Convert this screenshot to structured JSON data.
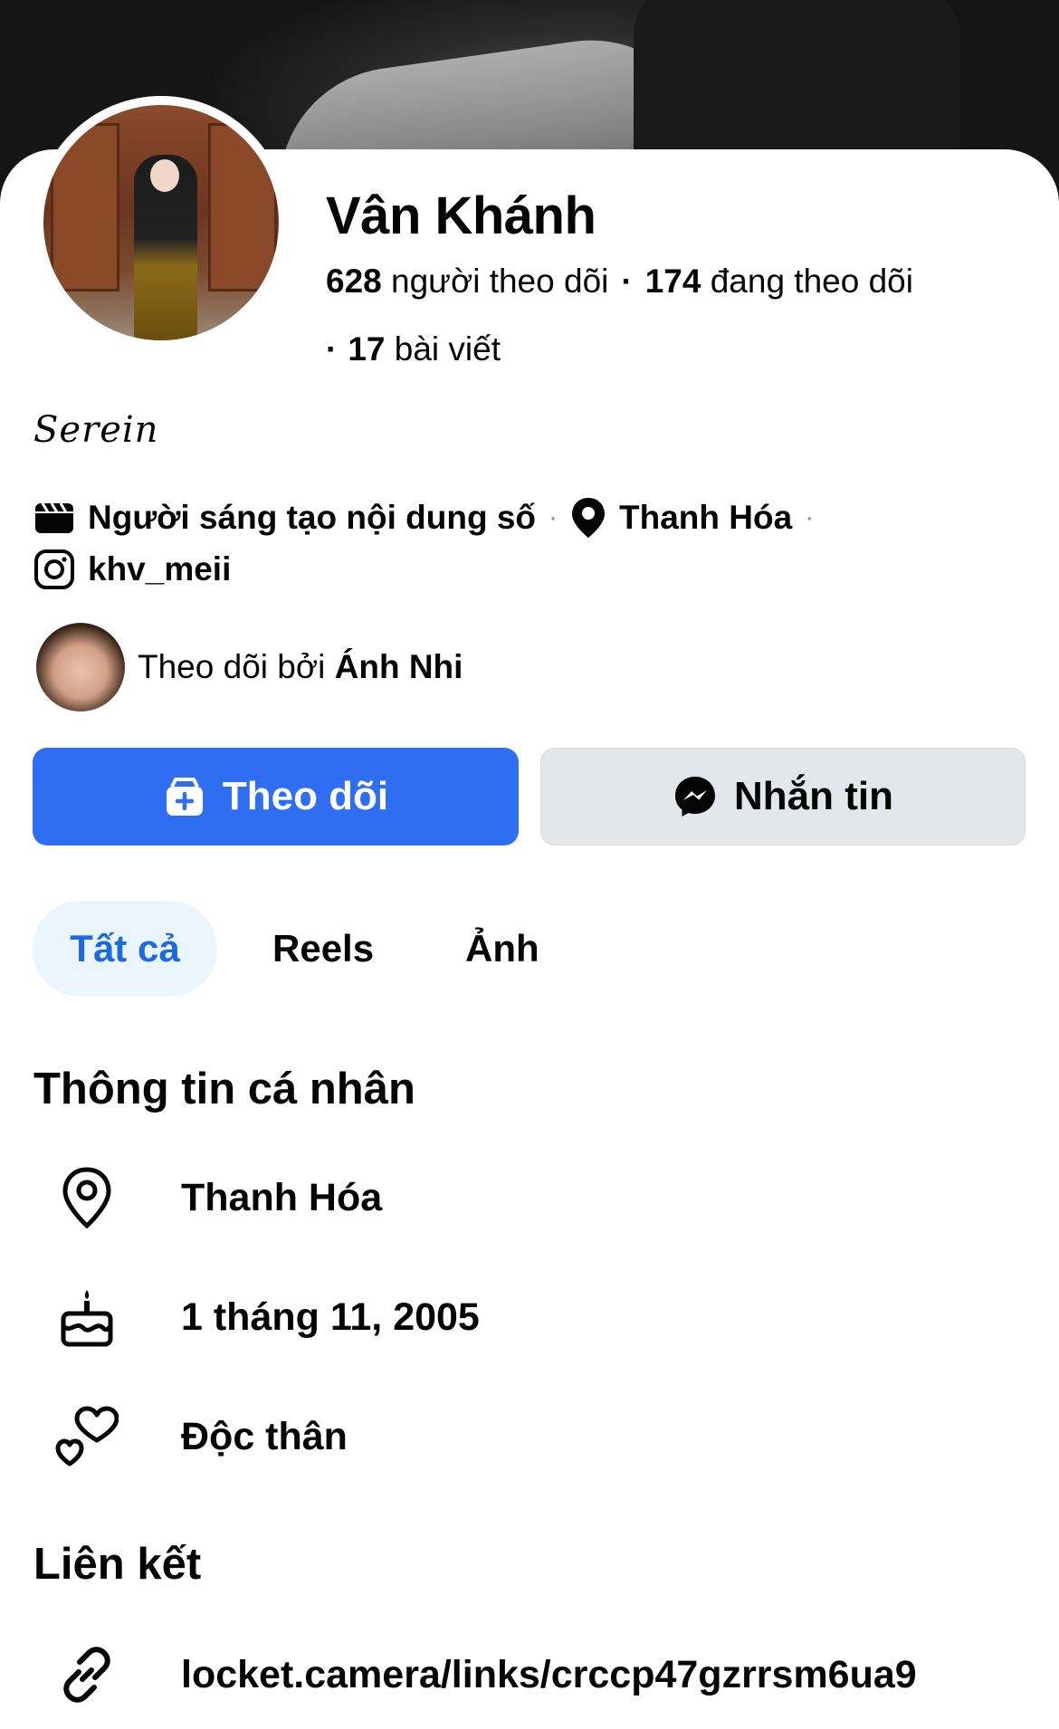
{
  "profile": {
    "name": "Vân Khánh",
    "followers_count": "628",
    "followers_label": "người theo dõi",
    "following_count": "174",
    "following_label": "đang theo dõi",
    "posts_count": "17",
    "posts_label": "bài viết",
    "bio": "𝑆𝑒𝑟𝑒𝑖𝑛"
  },
  "details": {
    "category": "Người sáng tạo nội dung số",
    "location": "Thanh Hóa",
    "instagram": "khv_meii"
  },
  "followed_by": {
    "prefix": "Theo dõi bởi",
    "name": "Ánh Nhi"
  },
  "actions": {
    "follow_label": "Theo dõi",
    "message_label": "Nhắn tin"
  },
  "tabs": [
    {
      "label": "Tất cả",
      "active": true
    },
    {
      "label": "Reels",
      "active": false
    },
    {
      "label": "Ảnh",
      "active": false
    }
  ],
  "personal_info": {
    "title": "Thông tin cá nhân",
    "location": "Thanh Hóa",
    "birthday": "1 tháng 11, 2005",
    "relationship": "Độc thân"
  },
  "links": {
    "title": "Liên kết",
    "url": "locket.camera/links/crccp47gzrrsm6ua9"
  },
  "colors": {
    "primary": "#2f6ef2",
    "tab_active_bg": "#ebf5ff",
    "tab_active_text": "#1b6ae0",
    "secondary_button": "#e4e6eb"
  }
}
